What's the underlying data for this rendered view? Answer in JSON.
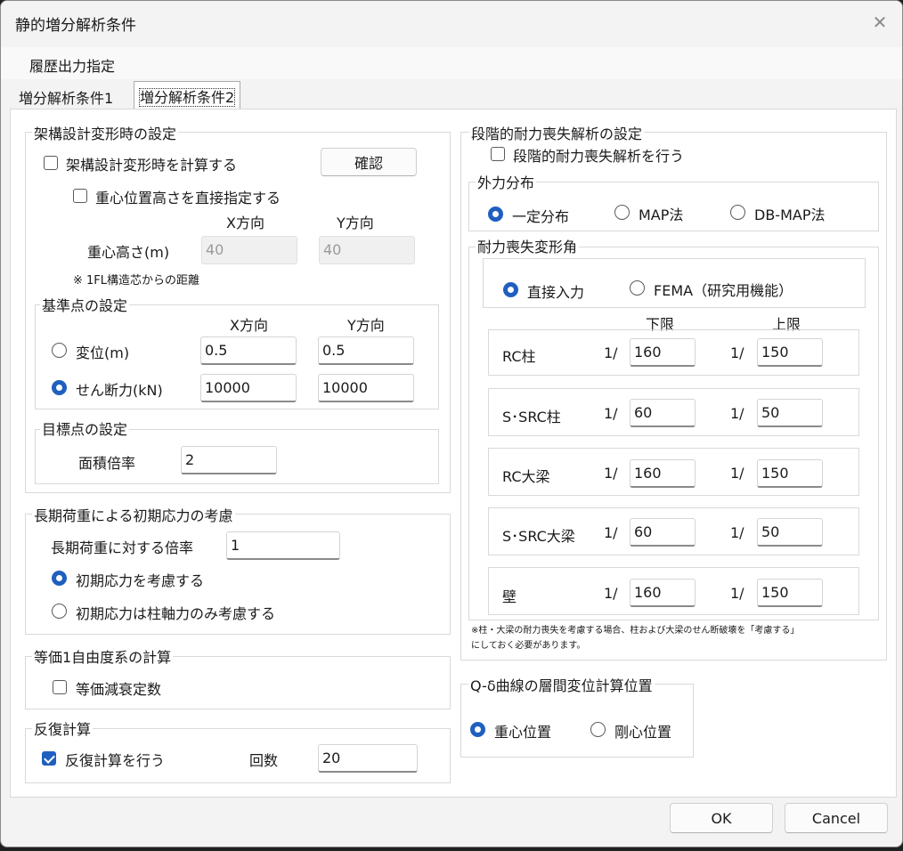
{
  "window": {
    "title": "静的増分解析条件"
  },
  "menu": {
    "history": "履歴出力指定"
  },
  "tabs": [
    {
      "label": "増分解析条件1"
    },
    {
      "label": "増分解析条件2"
    }
  ],
  "frame": {
    "title": "架構設計変形時の設定",
    "calc_label": "架構設計変形時を計算する",
    "calc_checked": false,
    "confirm_label": "確認",
    "direct_label": "重心位置高さを直接指定する",
    "direct_checked": false,
    "x_header": "X方向",
    "y_header": "Y方向",
    "height_label": "重心高さ(m)",
    "height_x": "40",
    "height_y": "40",
    "note": "※ 1FL構造芯からの距離"
  },
  "basepoint": {
    "title": "基準点の設定",
    "x_header": "X方向",
    "y_header": "Y方向",
    "disp_label": "変位(m)",
    "disp_x": "0.5",
    "disp_y": "0.5",
    "shear_label": "せん断力(kN)",
    "shear_x": "10000",
    "shear_y": "10000",
    "selected": "shear"
  },
  "target": {
    "title": "目標点の設定",
    "area_label": "面積倍率",
    "area_value": "2"
  },
  "longterm": {
    "title": "長期荷重による初期応力の考慮",
    "factor_label": "長期荷重に対する倍率",
    "factor_value": "1",
    "opt1": "初期応力を考慮する",
    "opt2": "初期応力は柱軸力のみ考慮する",
    "selected": "opt1"
  },
  "equiv": {
    "title": "等価1自由度系の計算",
    "damping_label": "等価減衰定数",
    "damping_checked": false
  },
  "iter": {
    "title": "反復計算",
    "do_label": "反復計算を行う",
    "do_checked": true,
    "count_label": "回数",
    "count_value": "20"
  },
  "staged": {
    "title": "段階的耐力喪失解析の設定",
    "do_label": "段階的耐力喪失解析を行う",
    "do_checked": false
  },
  "external": {
    "title": "外力分布",
    "opt1": "一定分布",
    "opt2": "MAP法",
    "opt3": "DB-MAP法",
    "selected": "opt1"
  },
  "loss": {
    "title": "耐力喪失変形角",
    "opt1": "直接入力",
    "opt2": "FEMA（研究用機能）",
    "selected": "opt1",
    "lower_header": "下限",
    "upper_header": "上限",
    "rows": [
      {
        "name": "RC柱",
        "lower_prefix": "1/",
        "lower": "160",
        "upper_prefix": "1/",
        "upper": "150"
      },
      {
        "name": "S･SRC柱",
        "lower_prefix": "1/",
        "lower": "60",
        "upper_prefix": "1/",
        "upper": "50"
      },
      {
        "name": "RC大梁",
        "lower_prefix": "1/",
        "lower": "160",
        "upper_prefix": "1/",
        "upper": "150"
      },
      {
        "name": "S･SRC大梁",
        "lower_prefix": "1/",
        "lower": "60",
        "upper_prefix": "1/",
        "upper": "50"
      },
      {
        "name": "壁",
        "lower_prefix": "1/",
        "lower": "160",
        "upper_prefix": "1/",
        "upper": "150"
      }
    ],
    "note1": "※柱・大梁の耐力喪失を考慮する場合、柱および大梁のせん断破壊を「考慮する」",
    "note2": "にしておく必要があります。"
  },
  "qdelta": {
    "title": "Q-δ曲線の層間変位計算位置",
    "opt1": "重心位置",
    "opt2": "剛心位置",
    "selected": "opt1"
  },
  "buttons": {
    "ok": "OK",
    "cancel": "Cancel"
  }
}
